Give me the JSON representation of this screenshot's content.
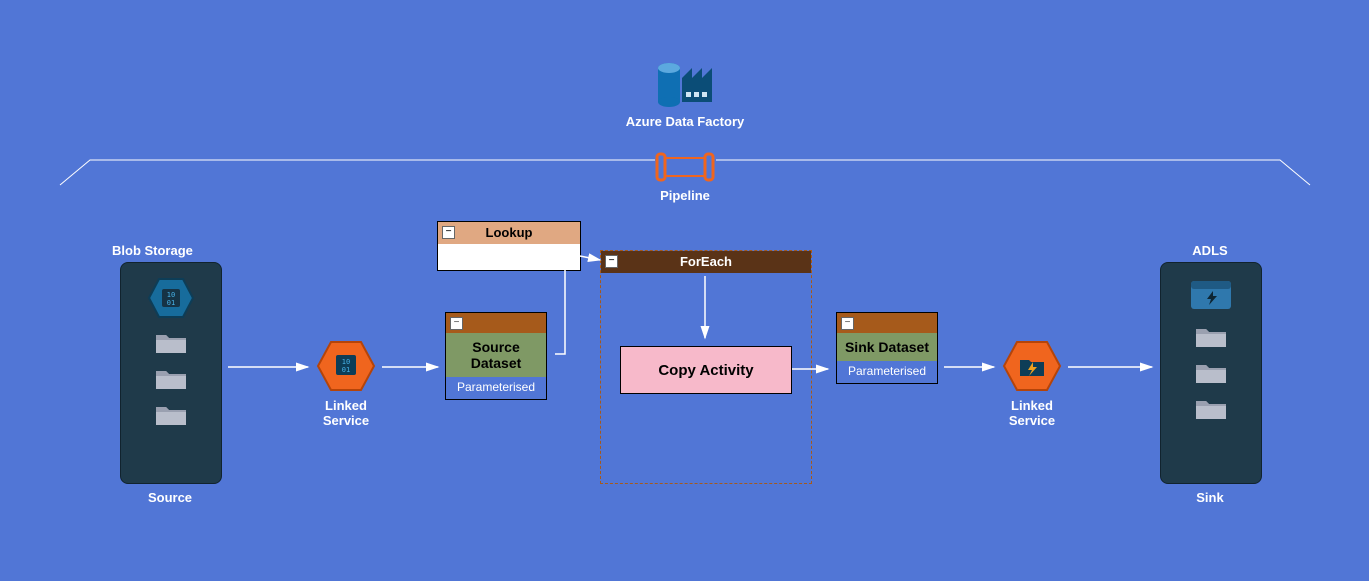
{
  "adf": {
    "label": "Azure Data Factory"
  },
  "pipeline": {
    "label": "Pipeline"
  },
  "source": {
    "title": "Blob Storage",
    "footer": "Source",
    "linked_service": "Linked Service"
  },
  "sink": {
    "title": "ADLS",
    "footer": "Sink",
    "linked_service": "Linked Service"
  },
  "source_dataset": {
    "title": "Source Dataset",
    "param": "Parameterised"
  },
  "sink_dataset": {
    "title": "Sink Dataset",
    "param": "Parameterised"
  },
  "lookup": {
    "label": "Lookup"
  },
  "foreach": {
    "label": "ForEach"
  },
  "copy": {
    "label": "Copy Activity"
  }
}
